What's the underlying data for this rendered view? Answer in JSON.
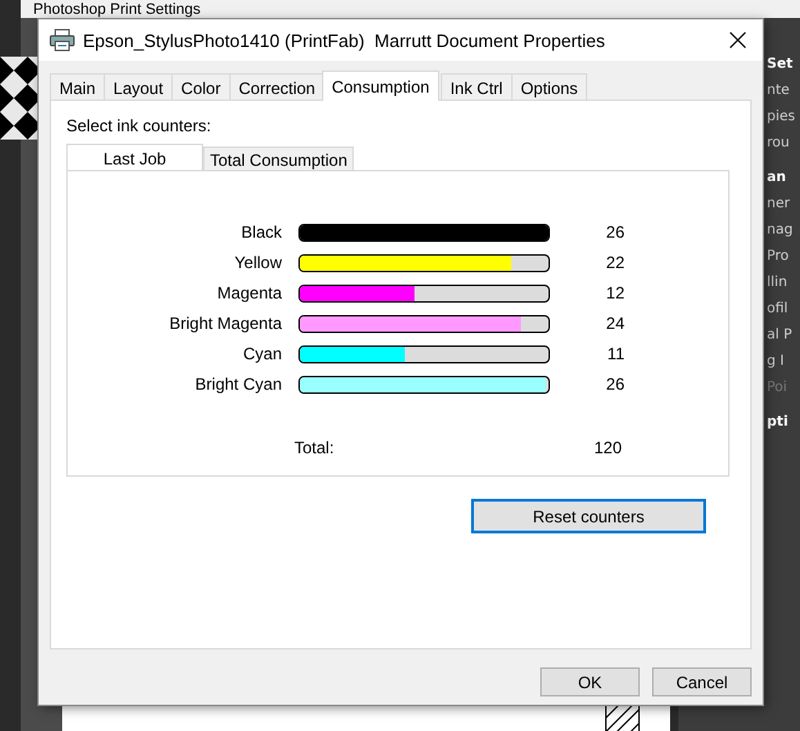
{
  "background_window": {
    "title": "Photoshop Print Settings",
    "panel_items": [
      {
        "text": "Set",
        "kind": "header"
      },
      {
        "text": "nte",
        "kind": "item"
      },
      {
        "text": "pies",
        "kind": "item"
      },
      {
        "text": "rou",
        "kind": "item"
      },
      {
        "text": "an",
        "kind": "header"
      },
      {
        "text": "ner",
        "kind": "item"
      },
      {
        "text": "nag",
        "kind": "item"
      },
      {
        "text": "Pro",
        "kind": "item"
      },
      {
        "text": "llin",
        "kind": "item"
      },
      {
        "text": "ofil",
        "kind": "item"
      },
      {
        "text": "al P",
        "kind": "item"
      },
      {
        "text": "g I",
        "kind": "item"
      },
      {
        "text": "Poi",
        "kind": "disabled"
      },
      {
        "text": "pti",
        "kind": "header"
      }
    ]
  },
  "dialog": {
    "title": "Epson_StylusPhoto1410 (PrintFab)  Marrutt Document Properties",
    "tabs": [
      {
        "label": "Main",
        "selected": false
      },
      {
        "label": "Layout",
        "selected": false
      },
      {
        "label": "Color",
        "selected": false
      },
      {
        "label": "Correction",
        "selected": false
      },
      {
        "label": "Consumption",
        "selected": true
      },
      {
        "label": "Ink Ctrl",
        "selected": false
      },
      {
        "label": "Options",
        "selected": false
      }
    ],
    "select_label": "Select ink counters:",
    "counter_tabs": [
      {
        "label": "Last Job",
        "selected": true
      },
      {
        "label": "Total Consumption",
        "selected": false
      }
    ],
    "inks": [
      {
        "name": "Black",
        "color": "#000000",
        "level": 1,
        "count": "26"
      },
      {
        "name": "Yellow",
        "color": "#ffff00",
        "level": 0.85,
        "count": "22"
      },
      {
        "name": "Magenta",
        "color": "#ff00ff",
        "level": 0.46,
        "count": "12"
      },
      {
        "name": "Bright Magenta",
        "color": "#ff99ff",
        "level": 0.89,
        "count": "24"
      },
      {
        "name": "Cyan",
        "color": "#00ffff",
        "level": 0.42,
        "count": "11"
      },
      {
        "name": "Bright Cyan",
        "color": "#99ffff",
        "level": 0.99,
        "count": "26"
      }
    ],
    "total_label": "Total:",
    "total": "120",
    "reset_button": "Reset counters",
    "buttons": [
      "OK",
      "Cancel"
    ]
  }
}
